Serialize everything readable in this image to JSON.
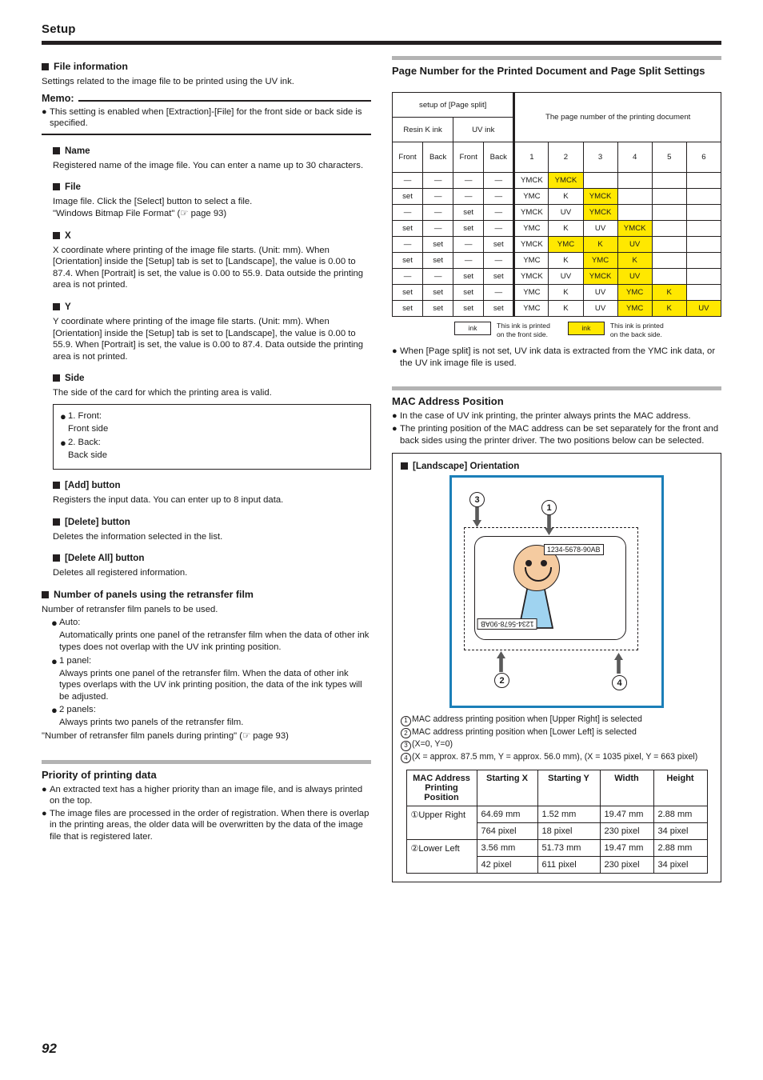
{
  "header": {
    "title": "Setup"
  },
  "footer": {
    "page_number": "92"
  },
  "left": {
    "file_information": {
      "heading": "File information",
      "intro": "Settings related to the image file to be printed using the UV ink.",
      "memo_label": "Memo:",
      "memo_items": [
        "This setting is enabled when [Extraction]-[File] for the front side or back side is specified."
      ]
    },
    "subsections": [
      {
        "heading": "Name",
        "body": [
          "Registered name of the image file. You can enter a name up to 30 characters."
        ]
      },
      {
        "heading": "File",
        "body": [
          "Image file. Click the [Select] button to select a file.",
          "\"Windows Bitmap File Format\" (☞ page 93)"
        ]
      },
      {
        "heading": "X",
        "body": [
          "X coordinate where printing of the image file starts. (Unit: mm). When [Orientation] inside the [Setup] tab is set to [Landscape], the value is 0.00 to 87.4. When [Portrait] is set, the value is 0.00 to 55.9. Data outside the printing area is not printed."
        ]
      },
      {
        "heading": "Y",
        "body": [
          "Y coordinate where printing of the image file starts. (Unit: mm). When [Orientation] inside the [Setup] tab is set to [Landscape], the value is 0.00 to 55.9. When [Portrait] is set, the value is 0.00 to 87.4. Data outside the printing area is not printed."
        ]
      }
    ],
    "side": {
      "heading": "Side",
      "body": "The side of the card for which the printing area is valid.",
      "options": [
        {
          "label": "1. Front:",
          "desc": "Front side"
        },
        {
          "label": "2. Back:",
          "desc": "Back side"
        }
      ]
    },
    "buttons": [
      {
        "heading": "[Add] button",
        "body": "Registers the input data. You can enter up to 8 input data."
      },
      {
        "heading": "[Delete] button",
        "body": "Deletes the information selected in the list."
      },
      {
        "heading": "[Delete All] button",
        "body": "Deletes all registered information."
      }
    ],
    "panels": {
      "heading": "Number of panels using the retransfer film",
      "intro": "Number of retransfer film panels to be used.",
      "items": [
        {
          "label": "Auto:",
          "desc": "Automatically prints one panel of the retransfer film when the data of other ink types does not overlap with the UV ink printing position."
        },
        {
          "label": "1 panel:",
          "desc": "Always prints one panel of the retransfer film. When the data of other ink types overlaps with the UV ink printing position, the data of the ink types will be adjusted."
        },
        {
          "label": "2 panels:",
          "desc": "Always prints two panels of the retransfer film."
        }
      ],
      "reference": "\"Number of retransfer film panels during printing\" (☞ page 93)"
    },
    "priority": {
      "title": "Priority of printing data",
      "items": [
        "An extracted text has a higher priority than an image file, and is always printed on the top.",
        "The image files are processed in the order of registration. When there is overlap in the printing areas, the older data will be overwritten by the data of the image file that is registered later."
      ]
    }
  },
  "right": {
    "page_split": {
      "title": "Page Number for the Printed Document and Page Split Settings",
      "table": {
        "group_left": "setup of [Page split]",
        "group_right": "The page number of the printing document",
        "ink_groups": [
          "Resin K ink",
          "UV ink"
        ],
        "side_headers": [
          "Front",
          "Back",
          "Front",
          "Back"
        ],
        "page_headers": [
          "1",
          "2",
          "3",
          "4",
          "5",
          "6"
        ],
        "rows": [
          {
            "setup": [
              "—",
              "—",
              "—",
              "—"
            ],
            "pages": [
              "YMCK",
              "YMCK",
              "",
              "",
              "",
              ""
            ],
            "back": [
              false,
              true,
              false,
              false,
              false,
              false
            ]
          },
          {
            "setup": [
              "set",
              "—",
              "—",
              "—"
            ],
            "pages": [
              "YMC",
              "K",
              "YMCK",
              "",
              "",
              ""
            ],
            "back": [
              false,
              false,
              true,
              false,
              false,
              false
            ]
          },
          {
            "setup": [
              "—",
              "—",
              "set",
              "—"
            ],
            "pages": [
              "YMCK",
              "UV",
              "YMCK",
              "",
              "",
              ""
            ],
            "back": [
              false,
              false,
              true,
              false,
              false,
              false
            ]
          },
          {
            "setup": [
              "set",
              "—",
              "set",
              "—"
            ],
            "pages": [
              "YMC",
              "K",
              "UV",
              "YMCK",
              "",
              ""
            ],
            "back": [
              false,
              false,
              false,
              true,
              false,
              false
            ]
          },
          {
            "setup": [
              "—",
              "set",
              "—",
              "set"
            ],
            "pages": [
              "YMCK",
              "YMC",
              "K",
              "UV",
              "",
              ""
            ],
            "back": [
              false,
              true,
              true,
              true,
              false,
              false
            ]
          },
          {
            "setup": [
              "set",
              "set",
              "—",
              "—"
            ],
            "pages": [
              "YMC",
              "K",
              "YMC",
              "K",
              "",
              ""
            ],
            "back": [
              false,
              false,
              true,
              true,
              false,
              false
            ]
          },
          {
            "setup": [
              "—",
              "—",
              "set",
              "set"
            ],
            "pages": [
              "YMCK",
              "UV",
              "YMCK",
              "UV",
              "",
              ""
            ],
            "back": [
              false,
              false,
              true,
              true,
              false,
              false
            ]
          },
          {
            "setup": [
              "set",
              "set",
              "set",
              "—"
            ],
            "pages": [
              "YMC",
              "K",
              "UV",
              "YMC",
              "K",
              ""
            ],
            "back": [
              false,
              false,
              false,
              true,
              true,
              false
            ]
          },
          {
            "setup": [
              "set",
              "set",
              "set",
              "set"
            ],
            "pages": [
              "YMC",
              "K",
              "UV",
              "YMC",
              "K",
              "UV"
            ],
            "back": [
              false,
              false,
              false,
              true,
              true,
              true
            ]
          }
        ]
      },
      "legend": [
        {
          "chip": "ink",
          "text_line1": "This ink is printed",
          "text_line2": "on the front side.",
          "highlight": false
        },
        {
          "chip": "ink",
          "text_line1": "This ink is printed",
          "text_line2": "on the back side.",
          "highlight": true
        }
      ],
      "note": "When [Page split] is not set, UV ink data is extracted from the YMC ink data, or the UV ink image file is used."
    },
    "mac": {
      "title": "MAC Address Position",
      "bullets": [
        "In the case of UV ink printing, the printer always prints the MAC address.",
        "The printing position of the MAC address can be set separately for the front and back sides using the printer driver. The two positions below can be selected."
      ],
      "diagram": {
        "heading": "[Landscape] Orientation",
        "mac_upper_right": "1234-5678-90AB",
        "mac_lower_left": "1234-5678-90AB",
        "callouts": [
          "1",
          "2",
          "3",
          "4"
        ]
      },
      "callout_list": [
        {
          "num": "1",
          "text": "MAC address printing position when [Upper Right] is selected"
        },
        {
          "num": "2",
          "text": "MAC address printing position when [Lower Left] is selected"
        },
        {
          "num": "3",
          "text": "(X=0, Y=0)"
        },
        {
          "num": "4",
          "text": "(X = approx. 87.5 mm, Y = approx. 56.0 mm), (X = 1035 pixel, Y = 663 pixel)"
        }
      ],
      "table": {
        "headers": [
          "MAC Address Printing Position",
          "Starting X",
          "Starting Y",
          "Width",
          "Height"
        ],
        "rows": [
          {
            "position": "①Upper Right",
            "mm": [
              "64.69 mm",
              "1.52 mm",
              "19.47 mm",
              "2.88 mm"
            ],
            "px": [
              "764 pixel",
              "18 pixel",
              "230 pixel",
              "34 pixel"
            ]
          },
          {
            "position": "②Lower Left",
            "mm": [
              "3.56 mm",
              "51.73 mm",
              "19.47 mm",
              "2.88 mm"
            ],
            "px": [
              "42 pixel",
              "611 pixel",
              "230 pixel",
              "34 pixel"
            ]
          }
        ]
      }
    }
  },
  "colors": {
    "highlight_yellow": "#FFE800",
    "section_bar_gray": "#b3b3b3",
    "diagram_border_blue": "#1B7FB8",
    "face_tan": "#F5CBA0",
    "body_blue": "#9FD3F0",
    "rule_black": "#231f20"
  }
}
